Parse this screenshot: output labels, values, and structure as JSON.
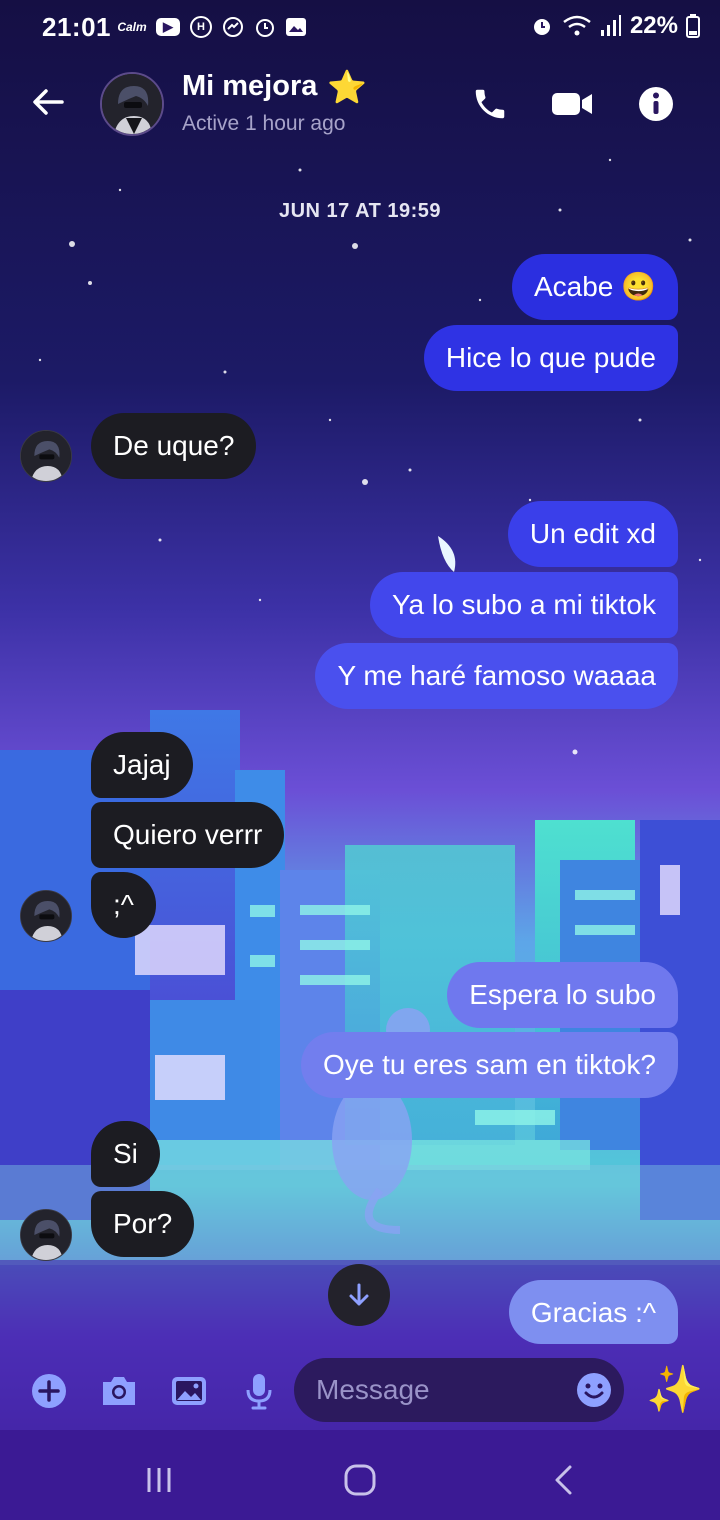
{
  "status_bar": {
    "time": "21:01",
    "left_icons": [
      "calm-icon",
      "youtube-icon",
      "hex-app-icon",
      "messenger-icon",
      "alarm-icon",
      "gallery-icon"
    ],
    "calm_text": "Calm",
    "battery": "22%"
  },
  "header": {
    "contact_name": "Mi mejora",
    "name_emoji": "⭐",
    "active_status": "Active 1 hour ago"
  },
  "conversation": {
    "date_label": "JUN 17 AT 19:59",
    "messages": [
      {
        "from": "me",
        "text": "Acabe 😀"
      },
      {
        "from": "me",
        "text": "Hice lo que pude"
      },
      {
        "from": "them",
        "text": "De uque?"
      },
      {
        "from": "me",
        "text": "Un edit xd"
      },
      {
        "from": "me",
        "text": "Ya lo subo a mi tiktok"
      },
      {
        "from": "me",
        "text": "Y me haré famoso waaaa"
      },
      {
        "from": "them",
        "text": "Jajaj"
      },
      {
        "from": "them",
        "text": "Quiero verrr"
      },
      {
        "from": "them",
        "text": ";^"
      },
      {
        "from": "me",
        "text": "Espera lo subo"
      },
      {
        "from": "me",
        "text": "Oye tu eres sam en tiktok?"
      },
      {
        "from": "them",
        "text": "Si"
      },
      {
        "from": "them",
        "text": "Por?"
      },
      {
        "from": "me",
        "text": "Gracias :^"
      }
    ]
  },
  "composer": {
    "placeholder": "Message",
    "sparkle_emoji": "✨"
  },
  "colors": {
    "bubble_out_top": "#2b2fe0",
    "bubble_out_mid": "#4a4ff0",
    "bubble_out_bottom": "#7e8ff0",
    "bubble_in": "#1c1c22",
    "accent_icon": "#8ea0ff"
  }
}
